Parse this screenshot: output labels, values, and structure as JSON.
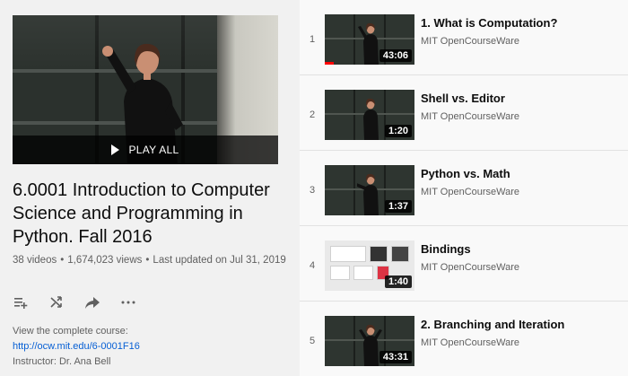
{
  "playlist": {
    "play_all_label": "PLAY ALL",
    "title": "6.0001 Introduction to Computer Science and Programming in Python. Fall 2016",
    "video_count": "38 videos",
    "views": "1,674,023 views",
    "last_updated": "Last updated on Jul 31, 2019",
    "description_line1": "View the complete course:",
    "course_link": "http://ocw.mit.edu/6-0001F16",
    "instructor": "Instructor: Dr. Ana Bell"
  },
  "actions": [
    {
      "name": "add-to-queue-icon"
    },
    {
      "name": "shuffle-icon"
    },
    {
      "name": "share-icon"
    },
    {
      "name": "more-options-icon"
    }
  ],
  "videos": [
    {
      "index": "1",
      "title": "1. What is Computation?",
      "channel": "MIT OpenCourseWare",
      "duration": "43:06",
      "watched": 0.1
    },
    {
      "index": "2",
      "title": "Shell vs. Editor",
      "channel": "MIT OpenCourseWare",
      "duration": "1:20"
    },
    {
      "index": "3",
      "title": "Python vs. Math",
      "channel": "MIT OpenCourseWare",
      "duration": "1:37"
    },
    {
      "index": "4",
      "title": "Bindings",
      "channel": "MIT OpenCourseWare",
      "duration": "1:40"
    },
    {
      "index": "5",
      "title": "2. Branching and Iteration",
      "channel": "MIT OpenCourseWare",
      "duration": "43:31"
    }
  ],
  "colors": {
    "link": "#065fd4",
    "progress": "#ff0000",
    "sidebar_bg": "#f1f1f1",
    "page_bg": "#f9f9f9"
  }
}
